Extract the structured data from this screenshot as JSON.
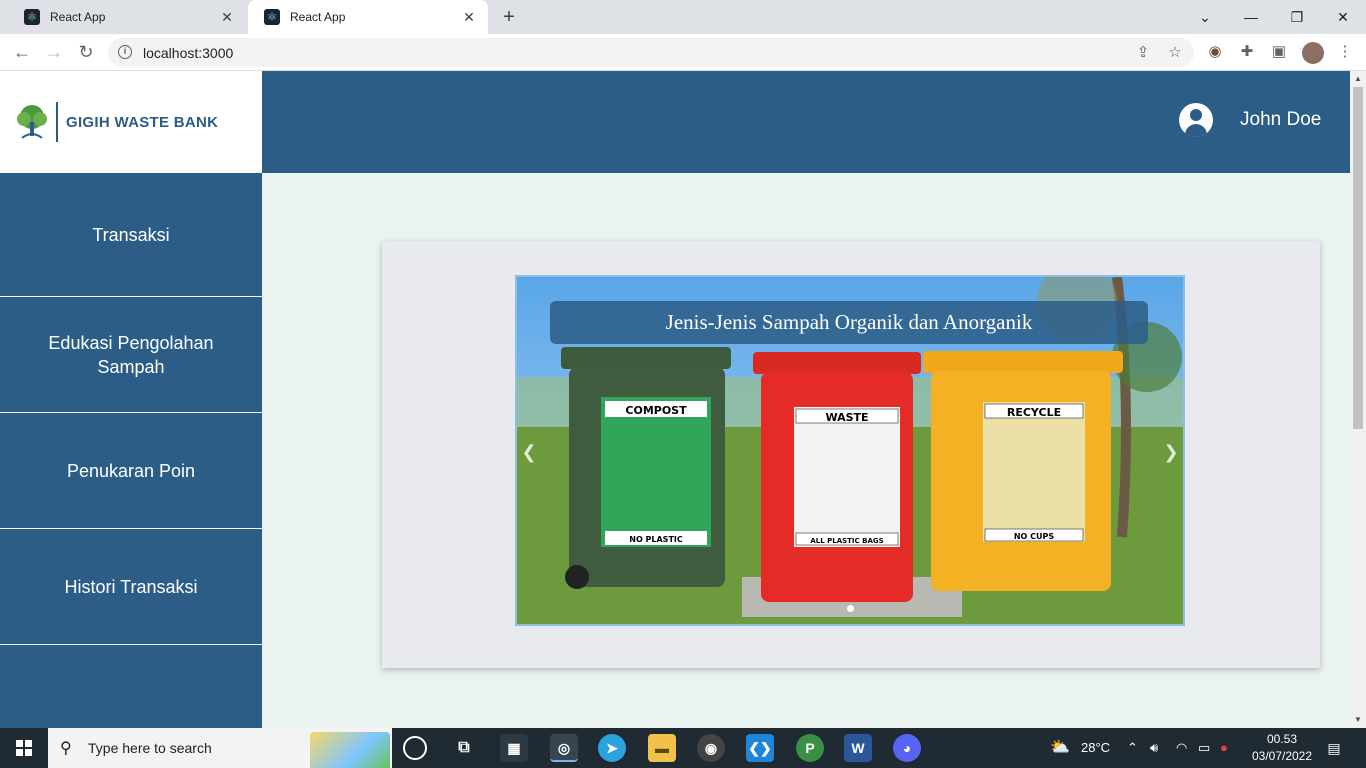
{
  "browser": {
    "tabs": [
      {
        "title": "React App"
      },
      {
        "title": "React App"
      }
    ],
    "url": "localhost:3000"
  },
  "app": {
    "brand": "GIGIH WASTE BANK",
    "user_name": "John Doe",
    "sidebar": [
      {
        "label": "Transaksi"
      },
      {
        "label": "Edukasi Pengolahan Sampah"
      },
      {
        "label": "Penukaran Poin"
      },
      {
        "label": "Histori Transaksi"
      }
    ],
    "carousel": {
      "caption": "Jenis-Jenis Sampah Organik dan Anorganik",
      "bins": [
        {
          "label": "COMPOST",
          "sublabel": "NO PLASTIC",
          "color": "#3d5a3c"
        },
        {
          "label": "WASTE",
          "sublabel": "ALL PLASTIC BAGS",
          "color": "#e52b25"
        },
        {
          "label": "RECYCLE",
          "sublabel": "NO CUPS",
          "color": "#f5b124"
        }
      ]
    }
  },
  "taskbar": {
    "search_placeholder": "Type here to search",
    "weather": "28°C",
    "time": "00.53",
    "date": "03/07/2022"
  },
  "colors": {
    "primary": "#2b5d87",
    "background": "#eaf3ef"
  }
}
